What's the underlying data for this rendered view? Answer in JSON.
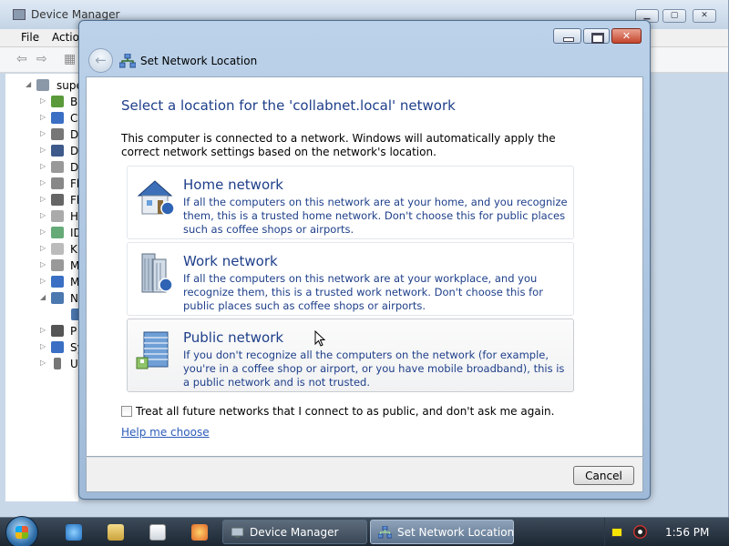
{
  "background_window": {
    "title": "Device Manager",
    "menu": [
      "File",
      "Actio"
    ],
    "tree": {
      "root": "super",
      "items": [
        "Ba",
        "C",
        "D",
        "D",
        "D",
        "Fl",
        "Fl",
        "H",
        "ID",
        "K",
        "M",
        "M",
        "N",
        "",
        "P",
        "Sy",
        "U"
      ]
    }
  },
  "dialog": {
    "title": "Set Network Location",
    "heading": "Select a location for the 'collabnet.local' network",
    "intro": "This computer is connected to a network. Windows will automatically apply the correct network settings based on the network's location.",
    "options": [
      {
        "title": "Home network",
        "description": "If all the computers on this network are at your home, and you recognize them, this is a trusted home network.  Don't choose this for public places such as coffee shops or airports."
      },
      {
        "title": "Work network",
        "description": "If all the computers on this network are at your workplace, and you recognize them, this is a trusted work network.  Don't choose this for public places such as coffee shops or airports."
      },
      {
        "title": "Public network",
        "description": "If you don't recognize all the computers on the network (for example, you're in a coffee shop or airport, or you have mobile broadband), this is a public network and is not trusted."
      }
    ],
    "checkbox_label": "Treat all future networks that I connect to as public, and don't ask me again.",
    "help_link": "Help me choose",
    "cancel_label": "Cancel"
  },
  "taskbar": {
    "tasks": [
      "Device Manager",
      "Set Network Location"
    ],
    "clock": "1:56 PM"
  },
  "colors": {
    "accent_text": "#1e3f8a",
    "link": "#2a5ab8",
    "close_button": "#c4452c"
  }
}
